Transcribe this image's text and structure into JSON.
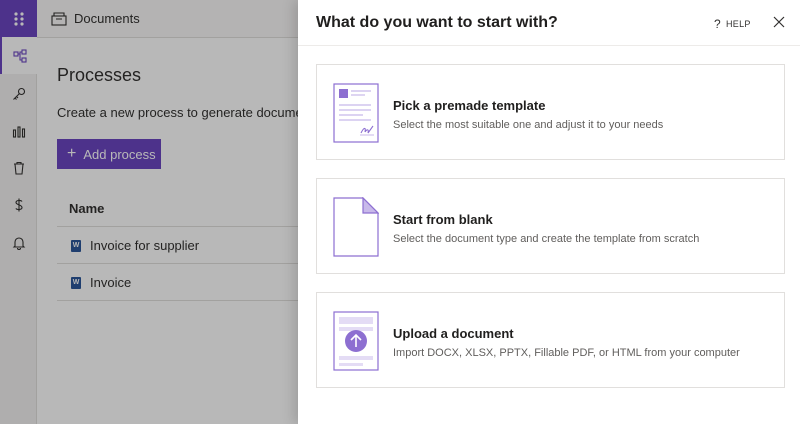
{
  "app": {
    "title": "Documents"
  },
  "rail": {
    "items": [
      {
        "icon": "process-icon",
        "active": true
      },
      {
        "icon": "key-icon"
      },
      {
        "icon": "chart-icon"
      },
      {
        "icon": "trash-icon"
      },
      {
        "icon": "dollar-icon"
      },
      {
        "icon": "bell-icon"
      }
    ]
  },
  "main": {
    "title": "Processes",
    "subtitle": "Create a new process to generate documents",
    "add_button": "Add process",
    "list_header": "Name",
    "rows": [
      {
        "name": "Invoice for supplier",
        "icon": "word-icon"
      },
      {
        "name": "Invoice",
        "icon": "word-icon"
      }
    ]
  },
  "panel": {
    "title": "What do you want to start with?",
    "help_label": "HELP",
    "options": [
      {
        "title": "Pick a premade template",
        "description": "Select the most suitable one and adjust it to your needs",
        "icon": "template-illustration"
      },
      {
        "title": "Start from blank",
        "description": "Select the document type and create the template from scratch",
        "icon": "blank-document-illustration"
      },
      {
        "title": "Upload a document",
        "description": "Import DOCX, XLSX, PPTX, Fillable PDF, or HTML from your computer",
        "icon": "upload-document-illustration"
      }
    ]
  },
  "colors": {
    "accent": "#6b46c1",
    "word": "#2b579a"
  }
}
